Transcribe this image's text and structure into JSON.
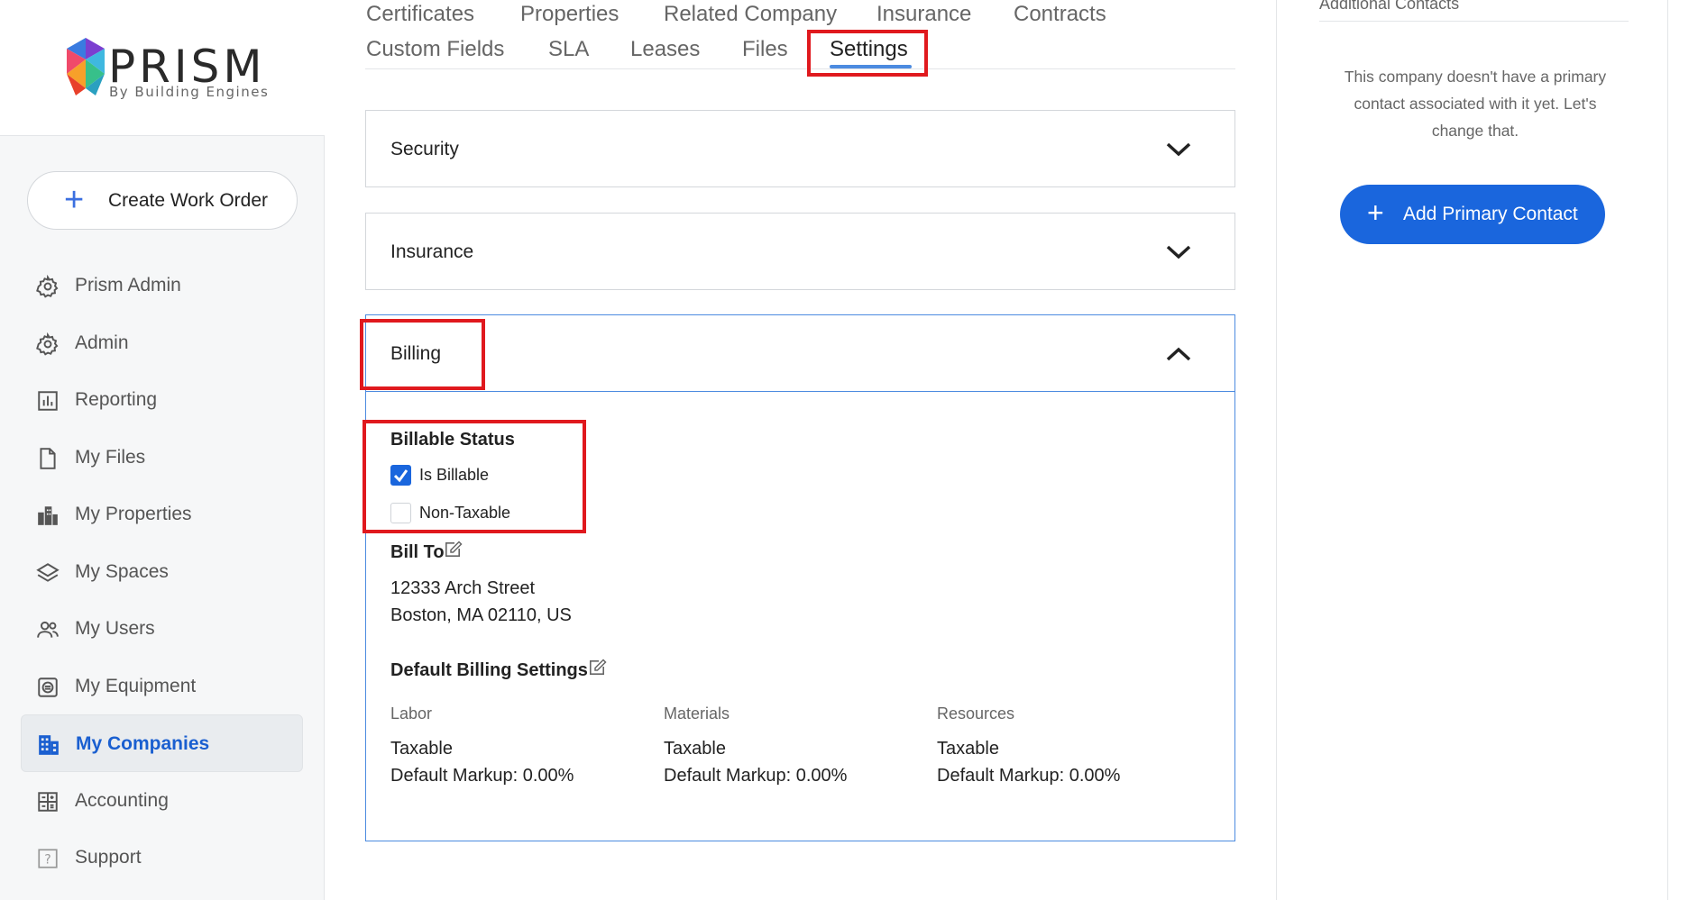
{
  "logo": {
    "name": "PRISM",
    "tagline": "By Building Engines"
  },
  "create_button": {
    "label": "Create Work Order"
  },
  "nav": {
    "items": [
      {
        "label": "Prism Admin",
        "icon": "gear-icon"
      },
      {
        "label": "Admin",
        "icon": "gear-icon"
      },
      {
        "label": "Reporting",
        "icon": "bar-chart-icon"
      },
      {
        "label": "My Files",
        "icon": "file-icon"
      },
      {
        "label": "My Properties",
        "icon": "building-icon"
      },
      {
        "label": "My Spaces",
        "icon": "layers-icon"
      },
      {
        "label": "My Users",
        "icon": "users-icon"
      },
      {
        "label": "My Equipment",
        "icon": "equipment-icon"
      },
      {
        "label": "My Companies",
        "icon": "companies-icon",
        "active": true
      },
      {
        "label": "Accounting",
        "icon": "calculator-icon"
      },
      {
        "label": "Support",
        "icon": "help-icon"
      }
    ]
  },
  "tabs": {
    "row1": [
      "Certificates",
      "Properties",
      "Related Company",
      "Insurance",
      "Contracts"
    ],
    "row2": [
      "Custom Fields",
      "SLA",
      "Leases",
      "Files",
      "Settings"
    ],
    "active": "Settings"
  },
  "accordions": {
    "security": "Security",
    "insurance": "Insurance",
    "billing": "Billing"
  },
  "billing": {
    "billable_status_label": "Billable Status",
    "is_billable": {
      "label": "Is Billable",
      "checked": true
    },
    "non_taxable": {
      "label": "Non-Taxable",
      "checked": false
    },
    "bill_to_label": "Bill To",
    "address_line1": "12333 Arch Street",
    "address_line2": "Boston, MA 02110, US",
    "default_settings_label": "Default Billing Settings",
    "columns": [
      {
        "header": "Labor",
        "tax": "Taxable",
        "markup": "Default Markup: 0.00%"
      },
      {
        "header": "Materials",
        "tax": "Taxable",
        "markup": "Default Markup: 0.00%"
      },
      {
        "header": "Resources",
        "tax": "Taxable",
        "markup": "Default Markup: 0.00%"
      }
    ]
  },
  "right_panel": {
    "heading": "Additional Contacts",
    "message": "This company doesn't have a primary contact associated with it yet. Let's change that.",
    "button_label": "Add Primary Contact"
  },
  "colors": {
    "accent": "#1a66dd",
    "highlight": "#e0191e",
    "active_nav": "#1a5fd0"
  }
}
